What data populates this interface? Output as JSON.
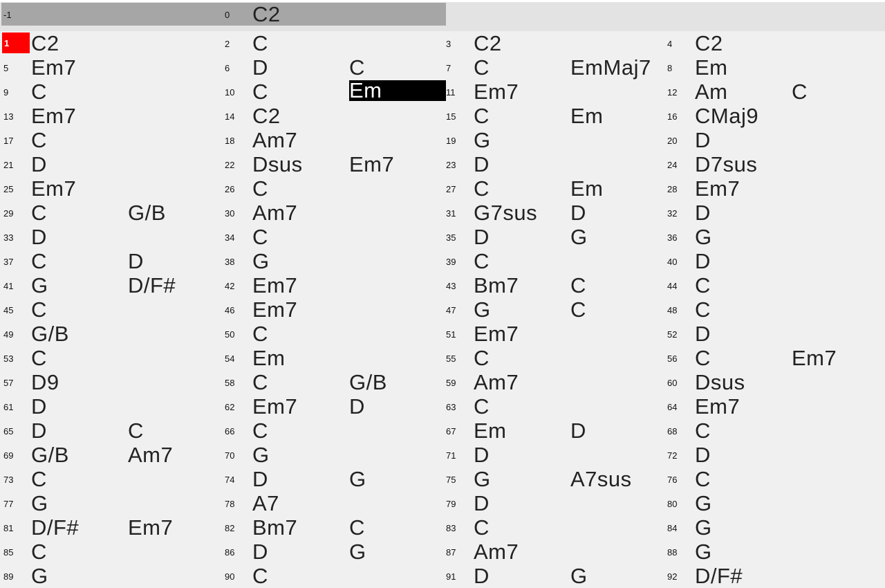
{
  "header_bars": [
    {
      "num": "-1",
      "chords": [
        "",
        ""
      ]
    },
    {
      "num": "0",
      "chords": [
        "C2",
        ""
      ]
    }
  ],
  "current_bar": "1",
  "selected": {
    "bar": "10",
    "slot": 1
  },
  "colors": {
    "current_bar": "#ff0000",
    "selection": "#000000",
    "header": "#a6a6a6"
  },
  "bars": [
    {
      "num": "1",
      "chords": [
        "C2",
        ""
      ]
    },
    {
      "num": "2",
      "chords": [
        "C",
        ""
      ]
    },
    {
      "num": "3",
      "chords": [
        "C2",
        ""
      ]
    },
    {
      "num": "4",
      "chords": [
        "C2",
        ""
      ]
    },
    {
      "num": "5",
      "chords": [
        "Em7",
        ""
      ]
    },
    {
      "num": "6",
      "chords": [
        "D",
        "C"
      ]
    },
    {
      "num": "7",
      "chords": [
        "C",
        "EmMaj7"
      ]
    },
    {
      "num": "8",
      "chords": [
        "Em",
        ""
      ]
    },
    {
      "num": "9",
      "chords": [
        "C",
        ""
      ]
    },
    {
      "num": "10",
      "chords": [
        "C",
        "Em"
      ]
    },
    {
      "num": "11",
      "chords": [
        "Em7",
        ""
      ]
    },
    {
      "num": "12",
      "chords": [
        "Am",
        "C"
      ]
    },
    {
      "num": "13",
      "chords": [
        "Em7",
        ""
      ]
    },
    {
      "num": "14",
      "chords": [
        "C2",
        ""
      ]
    },
    {
      "num": "15",
      "chords": [
        "C",
        "Em"
      ]
    },
    {
      "num": "16",
      "chords": [
        "CMaj9",
        ""
      ]
    },
    {
      "num": "17",
      "chords": [
        "C",
        ""
      ]
    },
    {
      "num": "18",
      "chords": [
        "Am7",
        ""
      ]
    },
    {
      "num": "19",
      "chords": [
        "G",
        ""
      ]
    },
    {
      "num": "20",
      "chords": [
        "D",
        ""
      ]
    },
    {
      "num": "21",
      "chords": [
        "D",
        ""
      ]
    },
    {
      "num": "22",
      "chords": [
        "Dsus",
        "Em7"
      ]
    },
    {
      "num": "23",
      "chords": [
        "D",
        ""
      ]
    },
    {
      "num": "24",
      "chords": [
        "D7sus",
        ""
      ]
    },
    {
      "num": "25",
      "chords": [
        "Em7",
        ""
      ]
    },
    {
      "num": "26",
      "chords": [
        "C",
        ""
      ]
    },
    {
      "num": "27",
      "chords": [
        "C",
        "Em"
      ]
    },
    {
      "num": "28",
      "chords": [
        "Em7",
        ""
      ]
    },
    {
      "num": "29",
      "chords": [
        "C",
        "G/B"
      ]
    },
    {
      "num": "30",
      "chords": [
        "Am7",
        ""
      ]
    },
    {
      "num": "31",
      "chords": [
        "G7sus",
        "D"
      ]
    },
    {
      "num": "32",
      "chords": [
        "D",
        ""
      ]
    },
    {
      "num": "33",
      "chords": [
        "D",
        ""
      ]
    },
    {
      "num": "34",
      "chords": [
        "C",
        ""
      ]
    },
    {
      "num": "35",
      "chords": [
        "D",
        "G"
      ]
    },
    {
      "num": "36",
      "chords": [
        "G",
        ""
      ]
    },
    {
      "num": "37",
      "chords": [
        "C",
        "D"
      ]
    },
    {
      "num": "38",
      "chords": [
        "G",
        ""
      ]
    },
    {
      "num": "39",
      "chords": [
        "C",
        ""
      ]
    },
    {
      "num": "40",
      "chords": [
        "D",
        ""
      ]
    },
    {
      "num": "41",
      "chords": [
        "G",
        "D/F#"
      ]
    },
    {
      "num": "42",
      "chords": [
        "Em7",
        ""
      ]
    },
    {
      "num": "43",
      "chords": [
        "Bm7",
        "C"
      ]
    },
    {
      "num": "44",
      "chords": [
        "C",
        ""
      ]
    },
    {
      "num": "45",
      "chords": [
        "C",
        ""
      ]
    },
    {
      "num": "46",
      "chords": [
        "Em7",
        ""
      ]
    },
    {
      "num": "47",
      "chords": [
        "G",
        "C"
      ]
    },
    {
      "num": "48",
      "chords": [
        "C",
        ""
      ]
    },
    {
      "num": "49",
      "chords": [
        "G/B",
        ""
      ]
    },
    {
      "num": "50",
      "chords": [
        "C",
        ""
      ]
    },
    {
      "num": "51",
      "chords": [
        "Em7",
        ""
      ]
    },
    {
      "num": "52",
      "chords": [
        "D",
        ""
      ]
    },
    {
      "num": "53",
      "chords": [
        "C",
        ""
      ]
    },
    {
      "num": "54",
      "chords": [
        "Em",
        ""
      ]
    },
    {
      "num": "55",
      "chords": [
        "C",
        ""
      ]
    },
    {
      "num": "56",
      "chords": [
        "C",
        "Em7"
      ]
    },
    {
      "num": "57",
      "chords": [
        "D9",
        ""
      ]
    },
    {
      "num": "58",
      "chords": [
        "C",
        "G/B"
      ]
    },
    {
      "num": "59",
      "chords": [
        "Am7",
        ""
      ]
    },
    {
      "num": "60",
      "chords": [
        "Dsus",
        ""
      ]
    },
    {
      "num": "61",
      "chords": [
        "D",
        ""
      ]
    },
    {
      "num": "62",
      "chords": [
        "Em7",
        "D"
      ]
    },
    {
      "num": "63",
      "chords": [
        "C",
        ""
      ]
    },
    {
      "num": "64",
      "chords": [
        "Em7",
        ""
      ]
    },
    {
      "num": "65",
      "chords": [
        "D",
        "C"
      ]
    },
    {
      "num": "66",
      "chords": [
        "C",
        ""
      ]
    },
    {
      "num": "67",
      "chords": [
        "Em",
        "D"
      ]
    },
    {
      "num": "68",
      "chords": [
        "C",
        ""
      ]
    },
    {
      "num": "69",
      "chords": [
        "G/B",
        "Am7"
      ]
    },
    {
      "num": "70",
      "chords": [
        "G",
        ""
      ]
    },
    {
      "num": "71",
      "chords": [
        "D",
        ""
      ]
    },
    {
      "num": "72",
      "chords": [
        "D",
        ""
      ]
    },
    {
      "num": "73",
      "chords": [
        "C",
        ""
      ]
    },
    {
      "num": "74",
      "chords": [
        "D",
        "G"
      ]
    },
    {
      "num": "75",
      "chords": [
        "G",
        "A7sus"
      ]
    },
    {
      "num": "76",
      "chords": [
        "C",
        ""
      ]
    },
    {
      "num": "77",
      "chords": [
        "G",
        ""
      ]
    },
    {
      "num": "78",
      "chords": [
        "A7",
        ""
      ]
    },
    {
      "num": "79",
      "chords": [
        "D",
        ""
      ]
    },
    {
      "num": "80",
      "chords": [
        "G",
        ""
      ]
    },
    {
      "num": "81",
      "chords": [
        "D/F#",
        "Em7"
      ]
    },
    {
      "num": "82",
      "chords": [
        "Bm7",
        "C"
      ]
    },
    {
      "num": "83",
      "chords": [
        "C",
        ""
      ]
    },
    {
      "num": "84",
      "chords": [
        "G",
        ""
      ]
    },
    {
      "num": "85",
      "chords": [
        "C",
        ""
      ]
    },
    {
      "num": "86",
      "chords": [
        "D",
        "G"
      ]
    },
    {
      "num": "87",
      "chords": [
        "Am7",
        ""
      ]
    },
    {
      "num": "88",
      "chords": [
        "G",
        ""
      ]
    },
    {
      "num": "89",
      "chords": [
        "G",
        ""
      ]
    },
    {
      "num": "90",
      "chords": [
        "C",
        ""
      ]
    },
    {
      "num": "91",
      "chords": [
        "D",
        "G"
      ]
    },
    {
      "num": "92",
      "chords": [
        "D/F#",
        ""
      ]
    }
  ]
}
